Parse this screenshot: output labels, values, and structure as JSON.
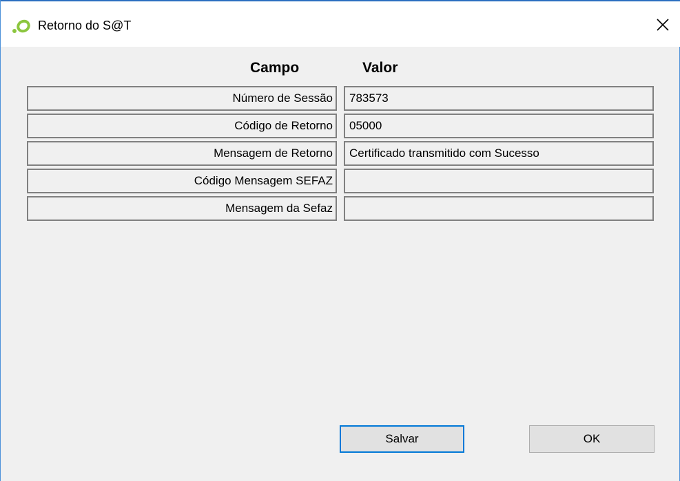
{
  "window": {
    "title": "Retorno do S@T",
    "icon": "sat-app-icon",
    "close_icon": "close-icon",
    "accent_color": "#0078d7"
  },
  "table": {
    "headers": {
      "field": "Campo",
      "value": "Valor"
    },
    "rows": [
      {
        "field": "Número de Sessão",
        "value": "783573"
      },
      {
        "field": "Código de Retorno",
        "value": "05000"
      },
      {
        "field": "Mensagem de Retorno",
        "value": "Certificado transmitido com Sucesso"
      },
      {
        "field": "Código Mensagem SEFAZ",
        "value": ""
      },
      {
        "field": "Mensagem da Sefaz",
        "value": ""
      }
    ]
  },
  "buttons": {
    "save_label": "Salvar",
    "ok_label": "OK"
  }
}
